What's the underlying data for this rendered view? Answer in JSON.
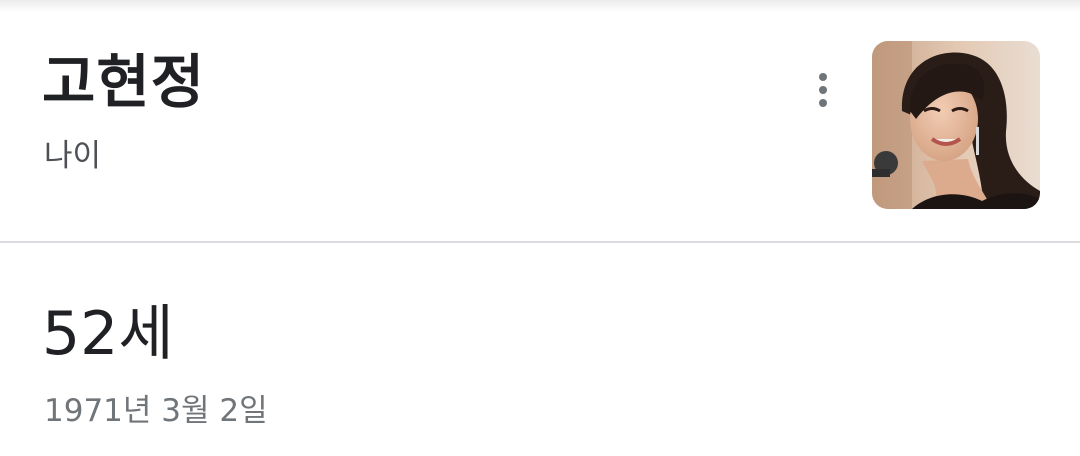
{
  "card": {
    "title": "고현정",
    "subtitle": "나이",
    "more_icon": "more-vert-icon",
    "thumbnail": "person-photo"
  },
  "result": {
    "answer": "52세",
    "detail": "1971년 3월 2일"
  },
  "colors": {
    "title": "#202124",
    "subtitle": "#4d5156",
    "detail": "#70757a",
    "divider": "#dadce0"
  }
}
